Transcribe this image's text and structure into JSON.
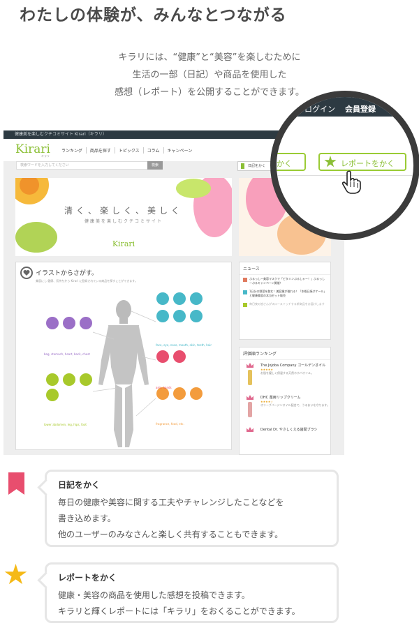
{
  "headline": "わたしの体験が、みんなとつながる",
  "intro": [
    "キラリには、“健康”と“美容”を楽しむために",
    "生活の一部（日記）や商品を使用した",
    "感想（レポート）を公開することができます。"
  ],
  "screenshot": {
    "topbar_text": "健康美を楽しむクチコミサイト Kirari（キラリ）",
    "logo": "Kirari",
    "logo_sub": "キラリ",
    "nav": [
      "ランキング",
      "商品を探す",
      "トピックス",
      "コラム",
      "キャンペーン"
    ],
    "search_placeholder": "検索ワードを入力してください",
    "search_button": "検索",
    "diary_button": "日記をかく",
    "hero": {
      "main": "清く、楽しく、美しく",
      "sub": "健康美を楽しむクチコミサイト",
      "logo": "Kirari",
      "side_button": "Kirari をはじめる"
    },
    "illustration": {
      "title": "イラストからさがす。",
      "desc": "美容にし 健康、気持ちから Kirari に登録されている商品を探すことができます。",
      "labels": [
        "face, eye, nose, mouth, skin, teeth, hair",
        "bag, stomach, heart, back, chest",
        "arm, hands",
        "lower abdomen, leg, hips, foot",
        "fragrance, food, etc."
      ]
    },
    "news": {
      "title": "ニュース",
      "items": [
        "ぷるっしー美容マスクで「ビタミンぷるしゃー！」ぷるっしーぷるキャンペーン開催！",
        "1日分の野菜を飲む！美容業が推れる！「本格日焼けケール」と健康美容の本当セット販売",
        "毎日夜の皆さんがスロースイッチする新商品をお届けします"
      ]
    },
    "ranking": {
      "title": "評価順ランキング",
      "items": [
        {
          "name": "The Jojoba Company ゴールデンオイル",
          "stars": "★★★★★",
          "desc": "お肌を優しく保湿する天然ホホバオイル。"
        },
        {
          "name": "DHC 薬用リップクリーム",
          "stars": "★★★★☆",
          "desc": "オリーブバージンオイル配合で、うるおいを守ります。"
        },
        {
          "name": "Dental Dr. やさしくえる歯間ブラシ",
          "stars": "",
          "desc": ""
        }
      ]
    }
  },
  "magnifier": {
    "login": "ログイン",
    "register": "会員登録",
    "diary_partial": "かく",
    "report_button": "レポートをかく"
  },
  "features": [
    {
      "icon": "bookmark-icon",
      "title": "日記をかく",
      "lines": [
        "毎日の健康や美容に関する工夫やチャレンジしたことなどを",
        "書き込めます。",
        "他のユーザーのみなさんと楽しく共有することもできます。"
      ]
    },
    {
      "icon": "star-icon",
      "title": "レポートをかく",
      "lines": [
        "健康・美容の商品を使用した感想を投稿できます。",
        "キラリと輝くレポートには「キラリ」をおくることができます。"
      ]
    }
  ],
  "colors": {
    "brand_green": "#8bbf35",
    "bookmark_pink": "#e84e6e",
    "star_yellow": "#f5b916",
    "dark_bar": "#2d3a42"
  }
}
